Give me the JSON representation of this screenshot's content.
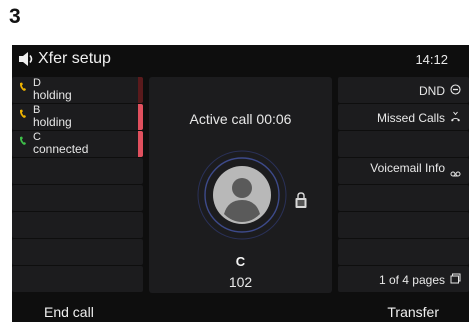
{
  "step_number": "3",
  "header": {
    "title": "Xfer setup",
    "time": "14:12",
    "speaker_icon": "speaker-icon"
  },
  "lines": [
    {
      "name": "D",
      "state": "holding",
      "phone_color": "#f0b400",
      "bar_color": "#5a1a1c"
    },
    {
      "name": "B",
      "state": "holding",
      "phone_color": "#f0b400",
      "bar_color": "#e0505e"
    },
    {
      "name": "C",
      "state": "connected",
      "phone_color": "#3ec04a",
      "bar_color": "#e0505e"
    },
    {
      "name": "",
      "state": ""
    },
    {
      "name": "",
      "state": ""
    },
    {
      "name": "",
      "state": ""
    },
    {
      "name": "",
      "state": ""
    },
    {
      "name": "",
      "state": ""
    }
  ],
  "call": {
    "status": "Active call 00:06",
    "name": "C",
    "number": "102",
    "srtp_icon": "srtp-lock-icon"
  },
  "right_keys": [
    {
      "label": "DND",
      "icon": "dnd-icon"
    },
    {
      "label": "Missed Calls",
      "icon": "missed-calls-icon"
    },
    {
      "label": "",
      "icon": ""
    },
    {
      "label": "Voicemail Info",
      "icon": "voicemail-icon"
    },
    {
      "label": "",
      "icon": ""
    },
    {
      "label": "",
      "icon": ""
    },
    {
      "label": "",
      "icon": ""
    },
    {
      "label": "1 of 4 pages",
      "icon": "pages-icon"
    }
  ],
  "softkeys": {
    "left": "End call",
    "right": "Transfer"
  }
}
